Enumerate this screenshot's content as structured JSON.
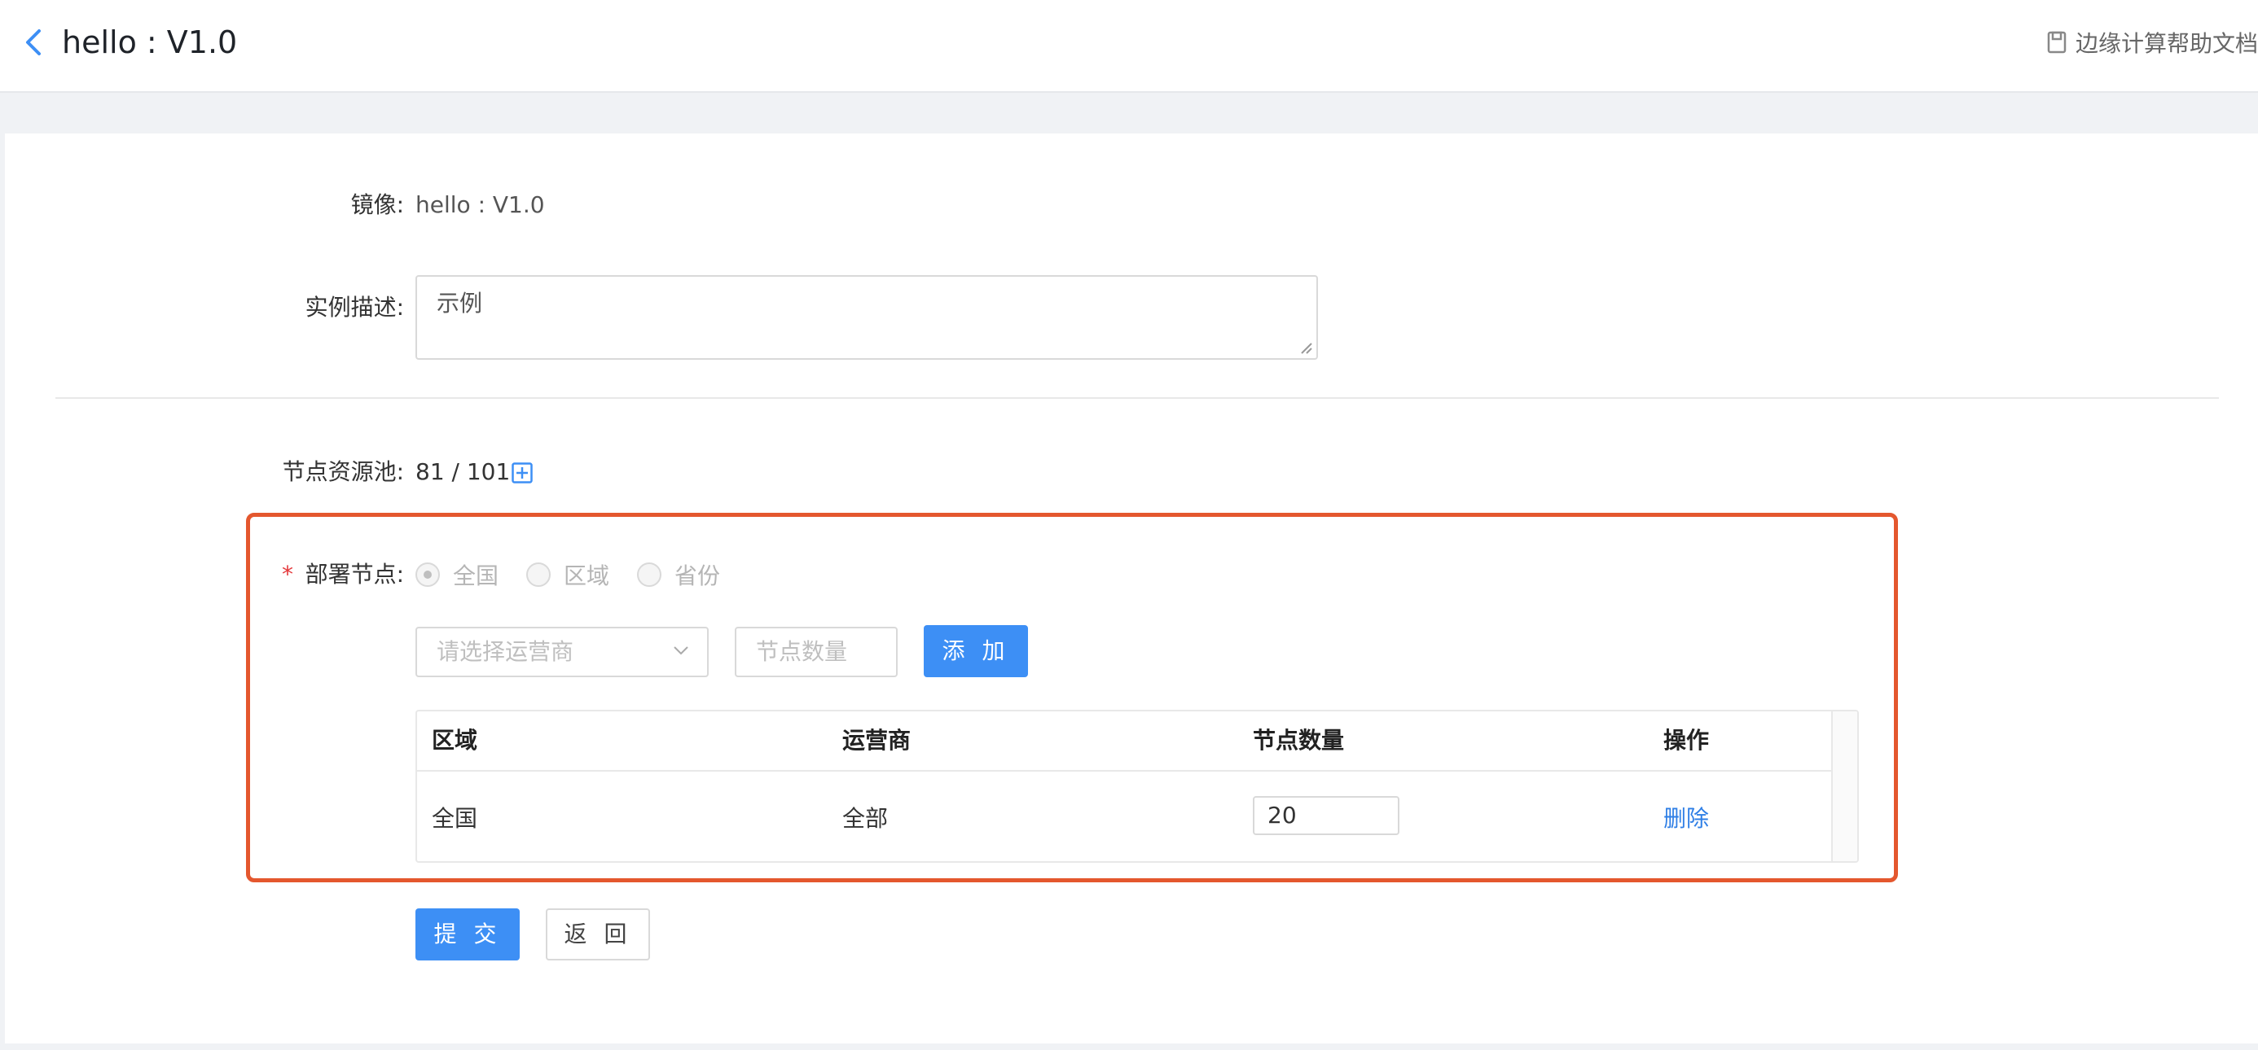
{
  "header": {
    "title": "hello : V1.0",
    "help_link": "边缘计算帮助文档"
  },
  "form": {
    "image_label": "镜像:",
    "image_value": "hello : V1.0",
    "description_label": "实例描述:",
    "description_value": "示例",
    "pool_label": "节点资源池:",
    "pool_value": "81 / 101",
    "deploy_label": "部署节点:",
    "required_mark": "*",
    "scope_options": [
      {
        "label": "全国",
        "checked": true
      },
      {
        "label": "区域",
        "checked": false
      },
      {
        "label": "省份",
        "checked": false
      }
    ],
    "carrier_placeholder": "请选择运营商",
    "count_placeholder": "节点数量",
    "add_button": "添 加",
    "submit_button": "提 交",
    "back_button": "返 回"
  },
  "table": {
    "columns": [
      "区域",
      "运营商",
      "节点数量",
      "操作"
    ],
    "rows": [
      {
        "region": "全国",
        "carrier": "全部",
        "count": "20",
        "action": "删除"
      }
    ]
  },
  "colors": {
    "accent": "#3d8ff5",
    "highlight": "#e4572e",
    "link": "#2f7fe6"
  }
}
